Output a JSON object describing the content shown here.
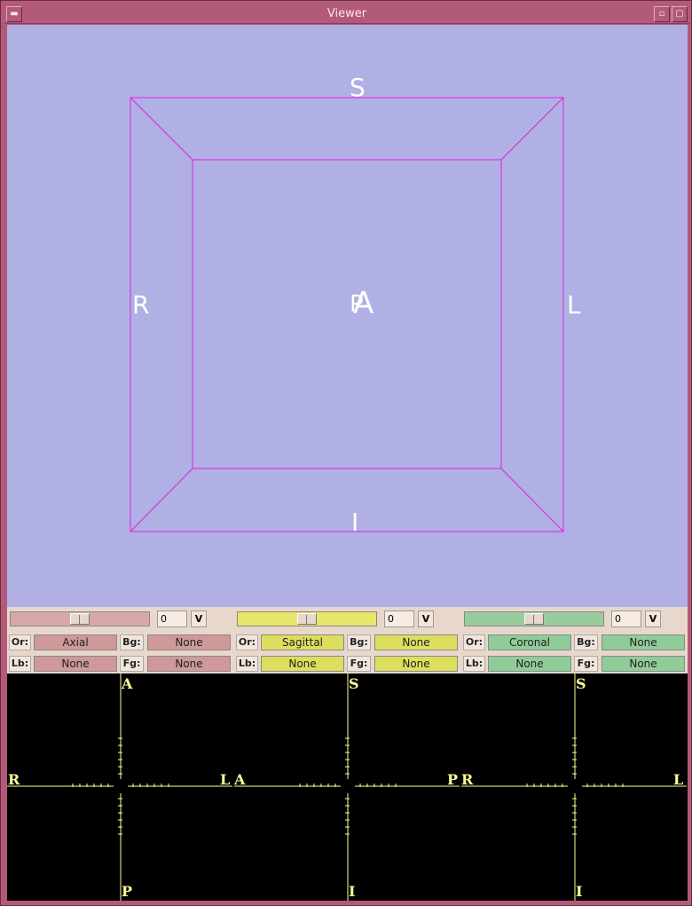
{
  "window": {
    "title": "Viewer",
    "menu_glyph": "▬",
    "min_glyph": "▫",
    "max_glyph": "▢"
  },
  "view3d": {
    "labels": {
      "top": "S",
      "bottom": "I",
      "left": "R",
      "right": "L",
      "center_back": "P",
      "center_front": "A"
    }
  },
  "colors": {
    "view_bg": "#b0b0e4",
    "box": "#e020e0",
    "axis_label": "#ffff99",
    "axial": "#d09898",
    "sagittal": "#dede5e",
    "coronal": "#90cc98"
  },
  "panels": [
    {
      "id": "axial",
      "slider_value": "0",
      "v_label": "V",
      "or_label": "Or:",
      "or_value": "Axial",
      "bg_label": "Bg:",
      "bg_value": "None",
      "lb_label": "Lb:",
      "lb_value": "None",
      "fg_label": "Fg:",
      "fg_value": "None"
    },
    {
      "id": "sagittal",
      "slider_value": "0",
      "v_label": "V",
      "or_label": "Or:",
      "or_value": "Sagittal",
      "bg_label": "Bg:",
      "bg_value": "None",
      "lb_label": "Lb:",
      "lb_value": "None",
      "fg_label": "Fg:",
      "fg_value": "None"
    },
    {
      "id": "coronal",
      "slider_value": "0",
      "v_label": "V",
      "or_label": "Or:",
      "or_value": "Coronal",
      "bg_label": "Bg:",
      "bg_value": "None",
      "lb_label": "Lb:",
      "lb_value": "None",
      "fg_label": "Fg:",
      "fg_value": "None"
    }
  ],
  "views2d": [
    {
      "top": "A",
      "bottom": "P",
      "left": "R",
      "right": "L"
    },
    {
      "top": "S",
      "bottom": "I",
      "left": "A",
      "right": "P"
    },
    {
      "top": "S",
      "bottom": "I",
      "left": "R",
      "right": "L"
    }
  ]
}
